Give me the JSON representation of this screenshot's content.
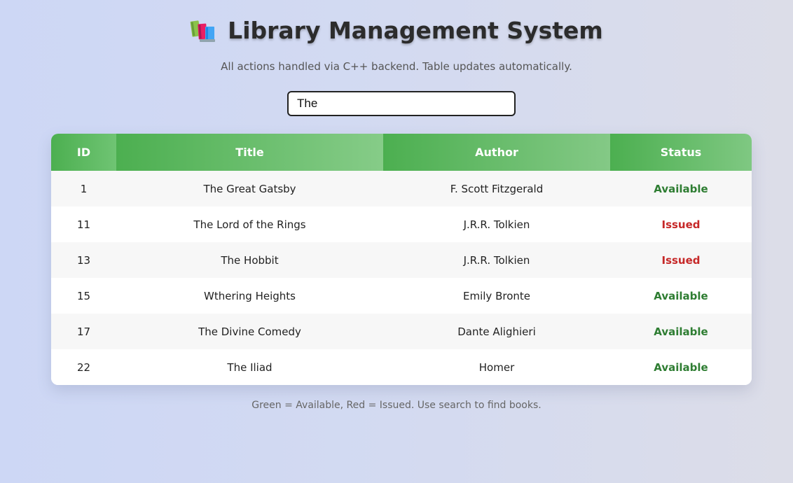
{
  "header": {
    "title": "Library Management System",
    "subtitle": "All actions handled via C++ backend. Table updates automatically.",
    "icon": "books-icon"
  },
  "search": {
    "value": "The",
    "placeholder": ""
  },
  "table": {
    "columns": [
      "ID",
      "Title",
      "Author",
      "Status"
    ],
    "rows": [
      {
        "id": "1",
        "title": "The Great Gatsby",
        "author": "F. Scott Fitzgerald",
        "status": "Available"
      },
      {
        "id": "11",
        "title": "The Lord of the Rings",
        "author": "J.R.R. Tolkien",
        "status": "Issued"
      },
      {
        "id": "13",
        "title": "The Hobbit",
        "author": "J.R.R. Tolkien",
        "status": "Issued"
      },
      {
        "id": "15",
        "title": "Wthering Heights",
        "author": "Emily Bronte",
        "status": "Available"
      },
      {
        "id": "17",
        "title": "The Divine Comedy",
        "author": "Dante Alighieri",
        "status": "Available"
      },
      {
        "id": "22",
        "title": "The Iliad",
        "author": "Homer",
        "status": "Available"
      }
    ]
  },
  "footer": {
    "note": "Green = Available, Red = Issued. Use search to find books."
  },
  "colors": {
    "header_green": "#4caf50",
    "available": "#2e7d32",
    "issued": "#c62828"
  }
}
